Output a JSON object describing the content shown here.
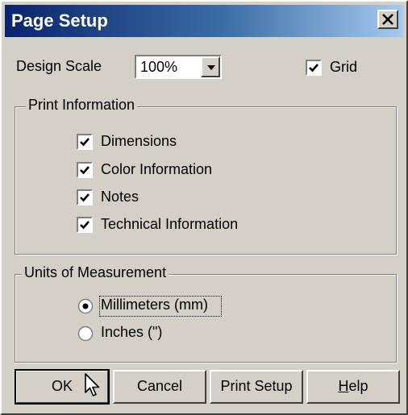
{
  "window": {
    "title": "Page Setup",
    "close_glyph": "✕"
  },
  "design_scale": {
    "label": "Design Scale",
    "selected": "100%"
  },
  "grid": {
    "label": "Grid",
    "checked": true
  },
  "print_information": {
    "title": "Print Information",
    "items": [
      {
        "label": "Dimensions",
        "checked": true
      },
      {
        "label": "Color Information",
        "checked": true
      },
      {
        "label": "Notes",
        "checked": true
      },
      {
        "label": "Technical Information",
        "checked": true
      }
    ]
  },
  "units": {
    "title": "Units of Measurement",
    "options": [
      {
        "label": "Millimeters (mm)",
        "selected": true
      },
      {
        "label": "Inches (\")",
        "selected": false
      }
    ]
  },
  "buttons": {
    "ok": "OK",
    "cancel": "Cancel",
    "print_setup": "Print Setup",
    "help_accel": "H",
    "help_rest": "elp"
  },
  "icons": {
    "close": "close-icon",
    "dropdown": "chevron-down-icon",
    "check": "check-icon",
    "radio": "radio-icon",
    "cursor": "mouse-pointer-icon"
  },
  "colors": {
    "face": "#d4d0c8",
    "title_start": "#0a246a",
    "title_end": "#a6caf0"
  }
}
